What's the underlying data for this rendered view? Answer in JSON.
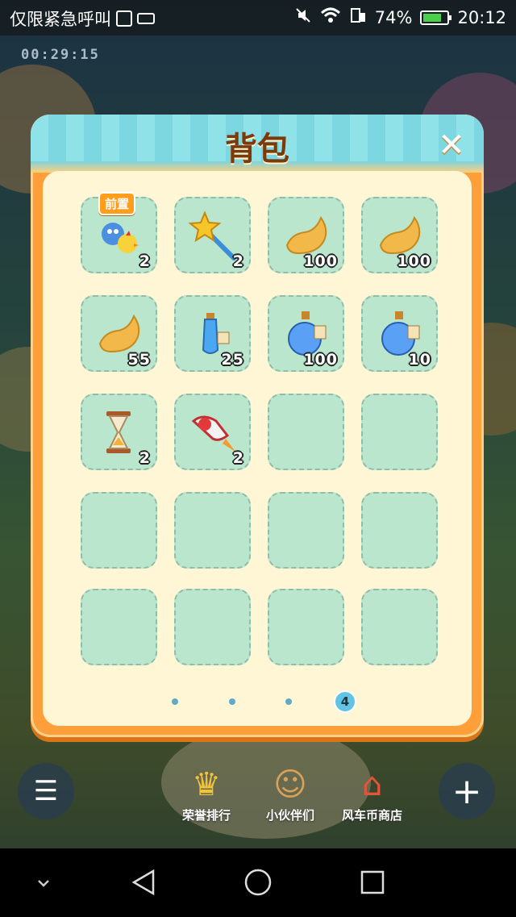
{
  "status_bar": {
    "carrier": "仅限紧急呼叫",
    "battery_percent": "74%",
    "time": "20:12",
    "icons": [
      "gallery-icon",
      "keyboard-icon",
      "mute-icon",
      "wifi-icon",
      "sim-icon",
      "battery-icon"
    ]
  },
  "background": {
    "timer": "00:29:15"
  },
  "dialog": {
    "title": "背包",
    "close_icon": "close-icon",
    "items": [
      {
        "name": "animal-pair",
        "qty": "2",
        "tag": "前置"
      },
      {
        "name": "star-wand",
        "qty": "2"
      },
      {
        "name": "golden-bean",
        "qty": "100"
      },
      {
        "name": "golden-bean",
        "qty": "100"
      },
      {
        "name": "golden-bean",
        "qty": "55"
      },
      {
        "name": "potion-plus1-bottle",
        "qty": "25"
      },
      {
        "name": "potion-plus5-flask",
        "qty": "100"
      },
      {
        "name": "potion-plus5-flask",
        "qty": "10"
      },
      {
        "name": "hourglass",
        "qty": "2"
      },
      {
        "name": "rocket",
        "qty": "2"
      },
      {
        "name": "empty"
      },
      {
        "name": "empty"
      },
      {
        "name": "empty"
      },
      {
        "name": "empty"
      },
      {
        "name": "empty"
      },
      {
        "name": "empty"
      },
      {
        "name": "empty"
      },
      {
        "name": "empty"
      },
      {
        "name": "empty"
      },
      {
        "name": "empty"
      }
    ],
    "pager": {
      "current": "4"
    }
  },
  "bottom_menu": {
    "ranking": "荣誉排行",
    "partners": "小伙伴们",
    "shop": "风车币商店"
  },
  "nav_bar": {
    "icons": [
      "collapse-icon",
      "back-icon",
      "home-icon",
      "recents-icon"
    ]
  }
}
